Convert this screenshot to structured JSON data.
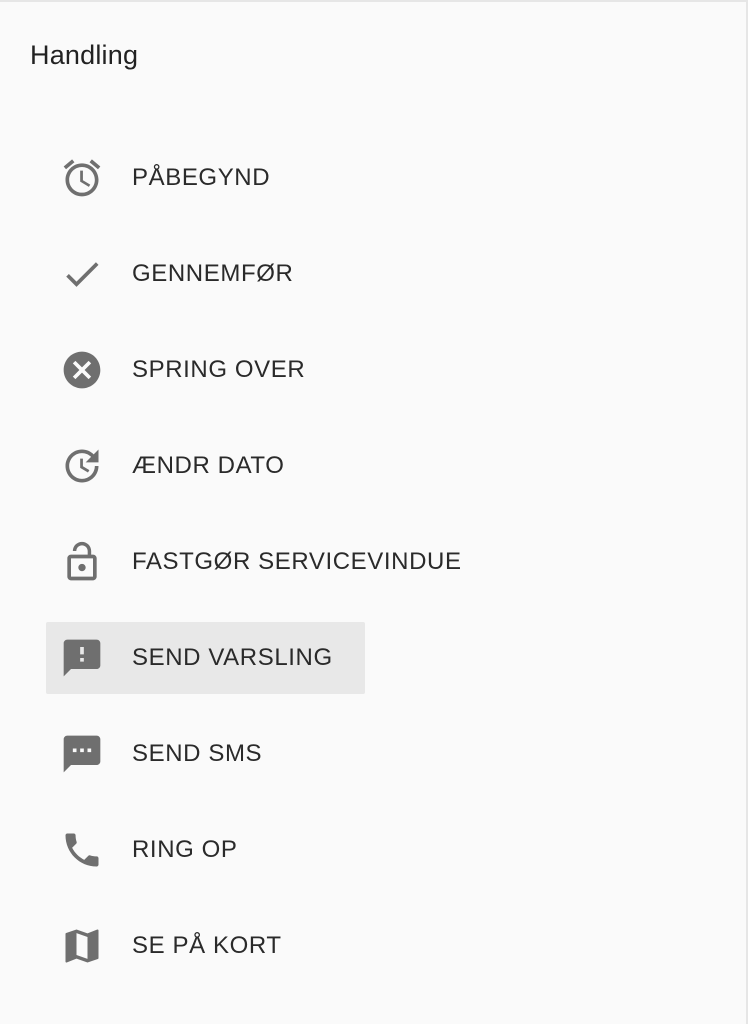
{
  "panel": {
    "title": "Handling"
  },
  "menu": {
    "items": [
      {
        "label": "PÅBEGYND",
        "icon": "alarm-clock-icon"
      },
      {
        "label": "GENNEMFØR",
        "icon": "checkmark-icon"
      },
      {
        "label": "SPRING OVER",
        "icon": "cancel-circle-icon"
      },
      {
        "label": "ÆNDR DATO",
        "icon": "reschedule-clock-icon"
      },
      {
        "label": "FASTGØR SERVICEVINDUE",
        "icon": "lock-open-icon"
      },
      {
        "label": "SEND VARSLING",
        "icon": "feedback-alert-icon",
        "active": true
      },
      {
        "label": "SEND SMS",
        "icon": "sms-bubble-icon"
      },
      {
        "label": "RING OP",
        "icon": "phone-icon"
      },
      {
        "label": "SE PÅ KORT",
        "icon": "map-icon"
      }
    ]
  },
  "colors": {
    "background": "#fafafa",
    "icon": "#6f6f6f",
    "text": "#2a2a2a",
    "active_background": "#e8e8e8"
  }
}
